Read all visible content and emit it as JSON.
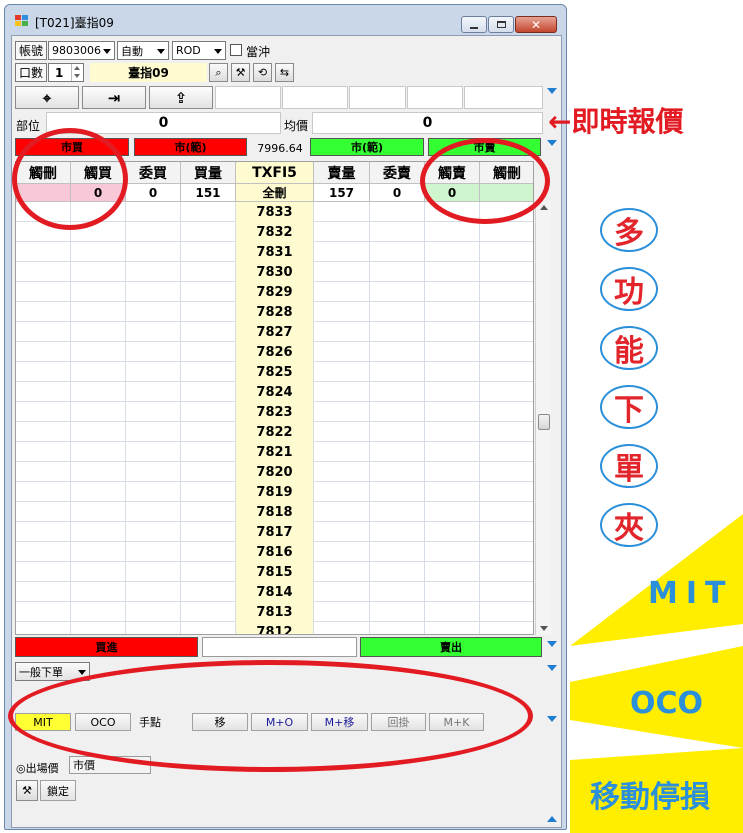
{
  "window": {
    "title": "[T021]臺指09"
  },
  "toolbar": {
    "account_label": "帳號",
    "account_value": "9803006",
    "mode_value": "自動",
    "order_type_value": "ROD",
    "daytrade_label": "當沖",
    "qty_label": "口數",
    "qty_value": "1",
    "product_name": "臺指09"
  },
  "position": {
    "label": "部位",
    "value": "0",
    "avg_label": "均價",
    "avg_value": "0"
  },
  "market_bars": {
    "buy_market": "市買",
    "buy_range": "市(範)",
    "last_price": "7996.64",
    "sell_range": "市(範)",
    "sell_market": "市賣"
  },
  "ladder": {
    "headers": [
      "觸刪",
      "觸買",
      "委買",
      "買量",
      "TXFI5",
      "賣量",
      "委賣",
      "觸賣",
      "觸刪"
    ],
    "summary": [
      "",
      "0",
      "0",
      "151",
      "全刪",
      "157",
      "0",
      "0",
      ""
    ],
    "prices": [
      "7833",
      "7832",
      "7831",
      "7830",
      "7829",
      "7828",
      "7827",
      "7826",
      "7825",
      "7824",
      "7823",
      "7822",
      "7821",
      "7820",
      "7819",
      "7818",
      "7817",
      "7816",
      "7815",
      "7814",
      "7813",
      "7812"
    ]
  },
  "actions": {
    "buy_label": "買進",
    "sell_label": "賣出"
  },
  "order_panel": {
    "order_mode": "一般下單",
    "tabs": [
      "MIT",
      "OCO",
      "手點",
      "移",
      "M+O",
      "M+移",
      "回掛",
      "M+K"
    ],
    "exit_price_label": "◎出場價",
    "exit_price_value": "市價",
    "lock_label": "鎖定"
  },
  "annotations": {
    "realtime_quote": "←即時報價",
    "vertical_chars": [
      "多",
      "功",
      "能",
      "下",
      "單",
      "夾"
    ],
    "mit": "MIT",
    "oco": "OCO",
    "trailing_stop": "移動停損"
  },
  "colors": {
    "buy_red": "#ff0000",
    "sell_green": "#33ff33",
    "price_yellow": "#fffbd0",
    "bid_pink": "#f9c8d8",
    "ask_green": "#cff5cf",
    "annotation_red": "#e21b23",
    "annotation_blue": "#2b8fd9",
    "banner_yellow": "#ffee00"
  }
}
